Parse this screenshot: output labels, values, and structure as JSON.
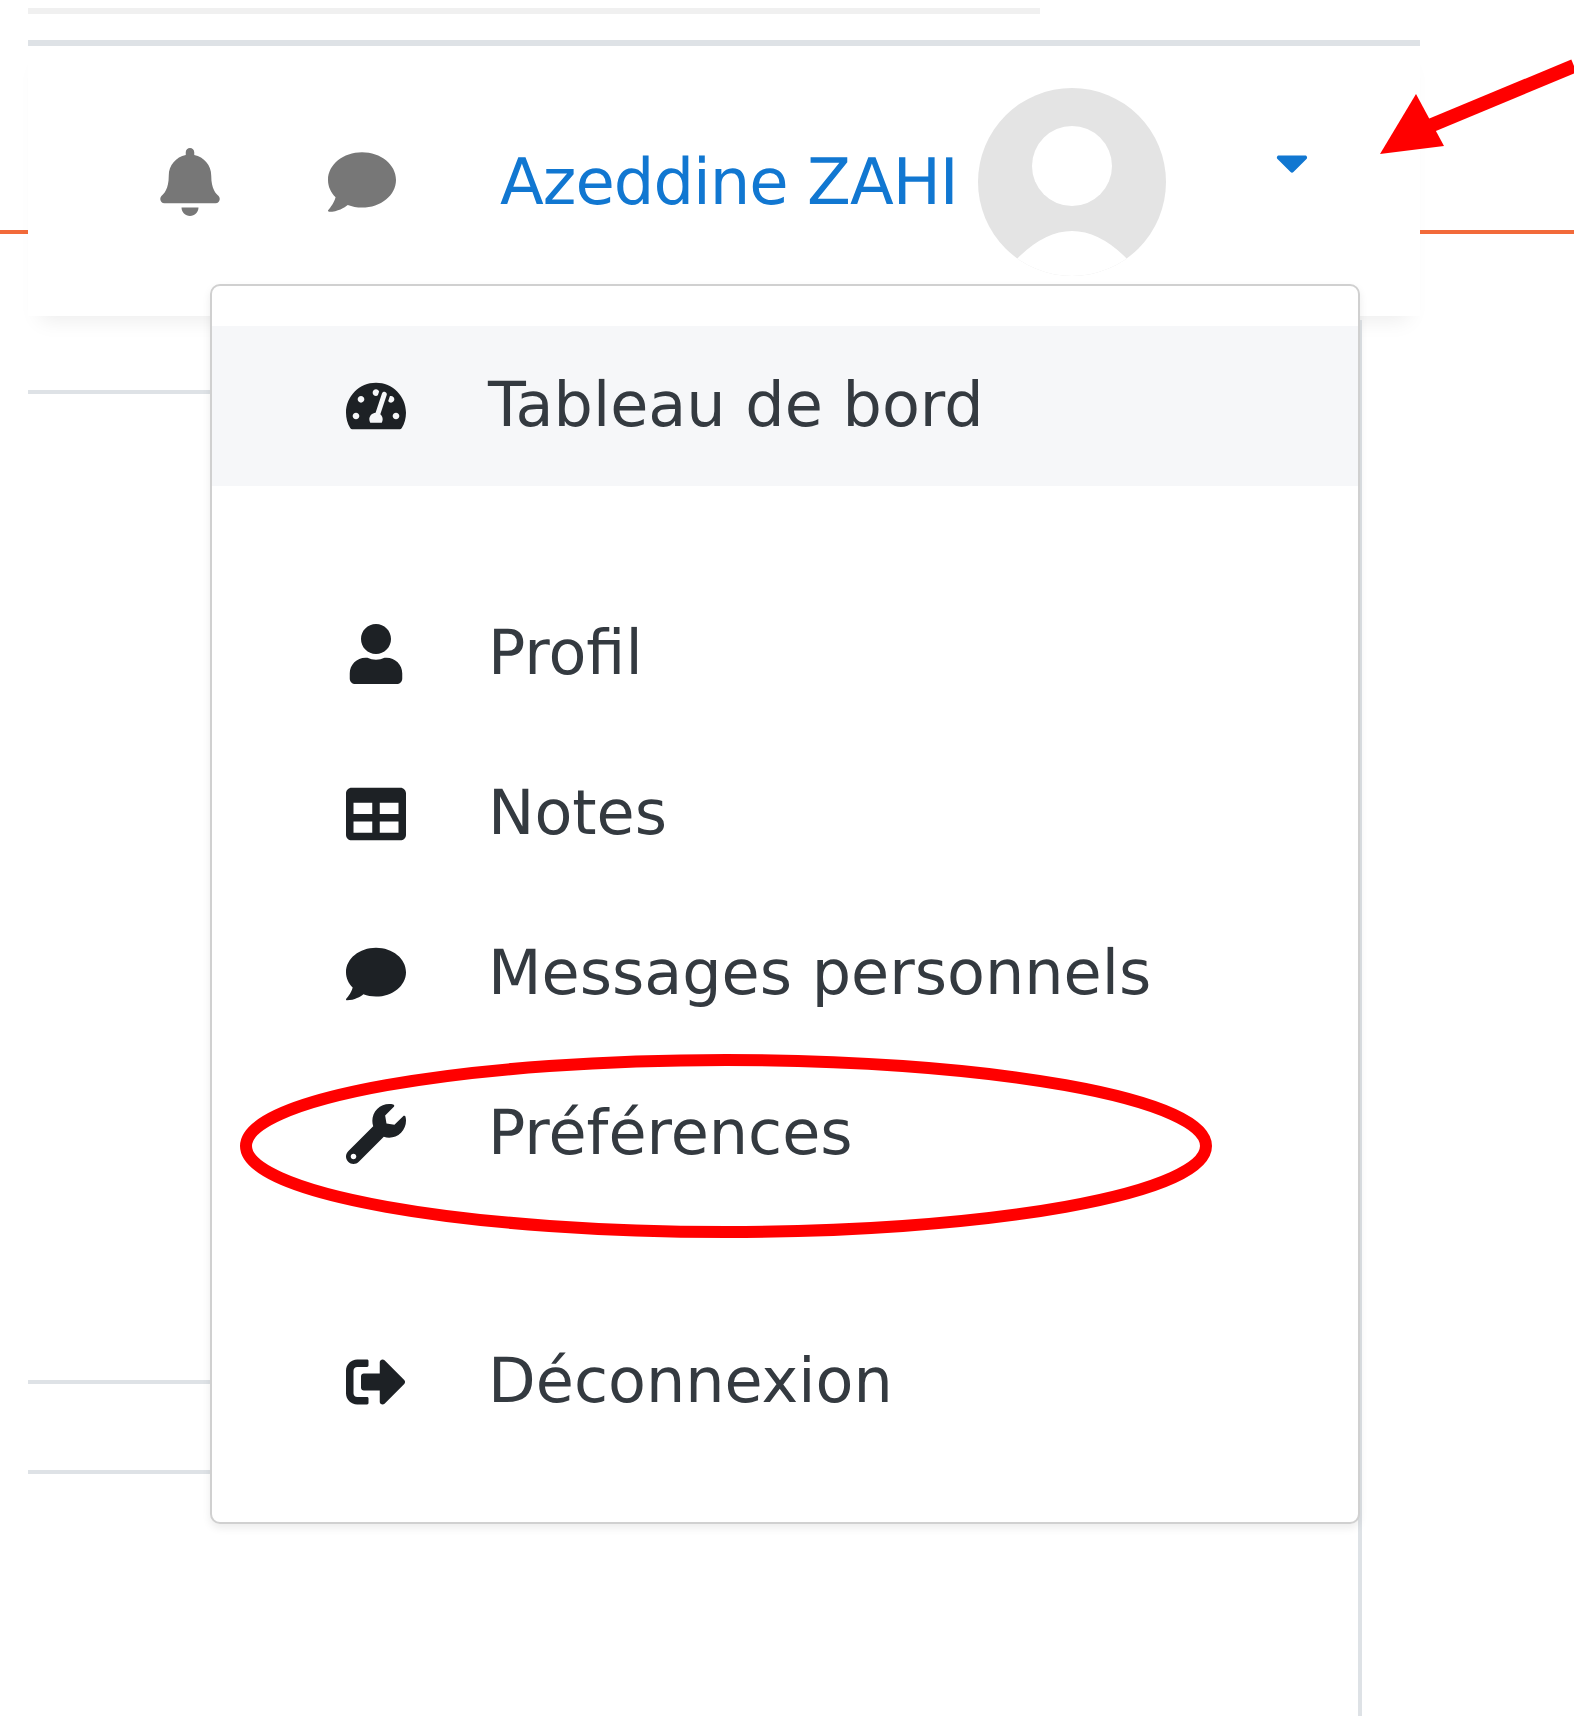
{
  "header": {
    "user_name": "Azeddine ZAHI",
    "menu_open": true
  },
  "menu": {
    "groups": [
      [
        {
          "label": "Tableau de bord",
          "selected": true
        }
      ],
      [
        {
          "label": "Profil",
          "selected": false
        },
        {
          "label": "Notes",
          "selected": false
        },
        {
          "label": "Messages personnels",
          "selected": false
        },
        {
          "label": "Préférences",
          "selected": false
        }
      ],
      [
        {
          "label": "Déconnexion",
          "selected": false
        }
      ]
    ]
  }
}
